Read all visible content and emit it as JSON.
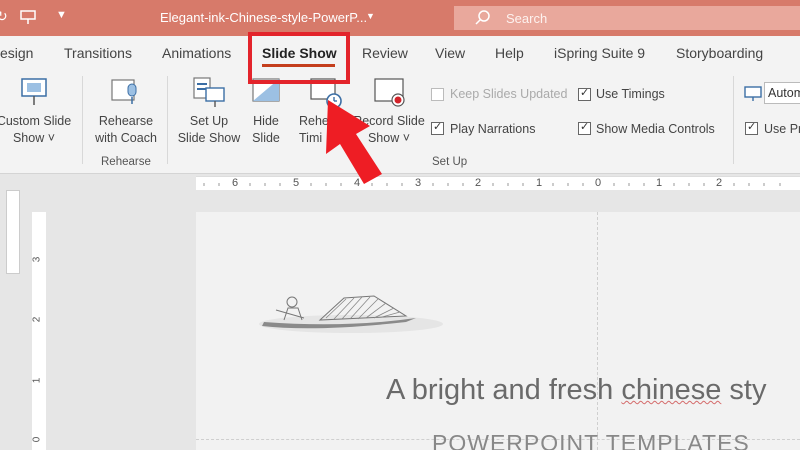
{
  "titlebar": {
    "title": "Elegant-ink-Chinese-style-PowerP...",
    "search_placeholder": "Search"
  },
  "tabs": {
    "items": [
      "esign",
      "Transitions",
      "Animations",
      "Review",
      "View",
      "Help",
      "iSpring Suite 9",
      "Storyboarding"
    ],
    "active": "Slide Show"
  },
  "ribbon": {
    "custom_slide_show": [
      "Custom Slide",
      "Show ˅"
    ],
    "rehearse_with_coach": [
      "Rehearse",
      "with Coach"
    ],
    "rehearse_group": "Rehearse",
    "set_up_slide_show": [
      "Set Up",
      "Slide Show"
    ],
    "hide_slide": [
      "Hide",
      "Slide"
    ],
    "rehearse_timings": [
      "Rehe",
      "Timi"
    ],
    "record_slide_show": [
      "Record Slide",
      "Show ˅"
    ],
    "keep_slides_updated": "Keep Slides Updated",
    "play_narrations": "Play Narrations",
    "use_timings": "Use Timings",
    "show_media_controls": "Show Media Controls",
    "setup_group": "Set Up",
    "monitor_value": "Autom",
    "use_presenter": "Use Pr"
  },
  "ruler": {
    "h_ticks": [
      "6",
      "5",
      "4",
      "3",
      "2",
      "1",
      "0",
      "1",
      "2"
    ],
    "v_ticks": [
      "3",
      "2",
      "1",
      "0"
    ]
  },
  "slide": {
    "title_prefix": "A bright and fresh ",
    "title_misspelled": "chinese",
    "title_suffix": " sty",
    "subtitle": "POWERPOINT TEMPLATES"
  },
  "colors": {
    "titlebar": "#d77a6a",
    "accent": "#c43e1c",
    "highlight": "#e3242b"
  }
}
